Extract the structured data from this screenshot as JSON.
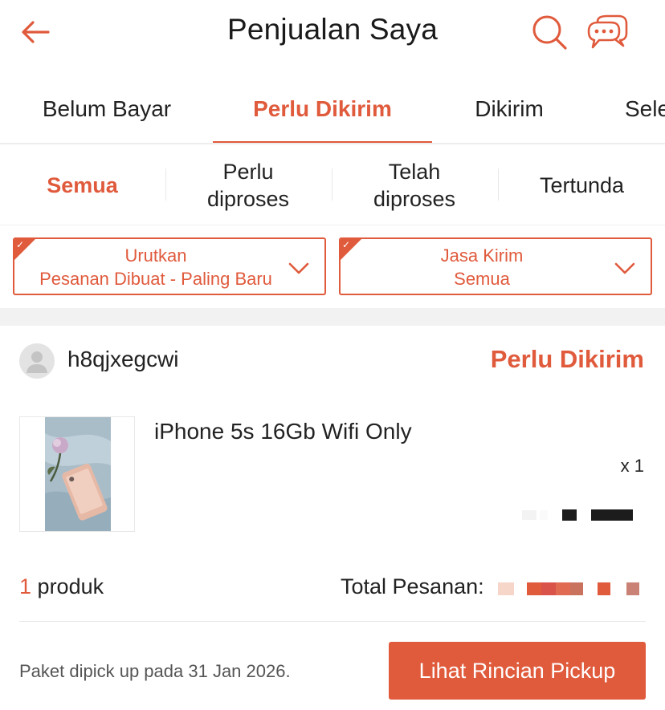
{
  "header": {
    "title": "Penjualan Saya",
    "back_icon": "arrow-left-icon",
    "search_icon": "search-icon",
    "chat_icon": "chat-icon",
    "accent_color": "#e05a3c"
  },
  "tabs": [
    {
      "label": "Belum Bayar",
      "active": false
    },
    {
      "label": "Perlu Dikirim",
      "active": true
    },
    {
      "label": "Dikirim",
      "active": false
    },
    {
      "label": "Selesai",
      "active": false
    }
  ],
  "subtabs": [
    {
      "label": "Semua",
      "active": true
    },
    {
      "label": "Perlu diproses",
      "active": false
    },
    {
      "label": "Telah diproses",
      "active": false
    },
    {
      "label": "Tertunda",
      "active": false
    }
  ],
  "filters": {
    "sort": {
      "label": "Urutkan",
      "value": "Pesanan Dibuat - Paling Baru"
    },
    "courier": {
      "label": "Jasa Kirim",
      "value": "Semua"
    }
  },
  "order": {
    "buyer": "h8qjxegcwi",
    "status": "Perlu Dikirim",
    "product_name": "iPhone 5s 16Gb Wifi Only",
    "quantity": "x 1",
    "product_count": "1",
    "product_count_label": "produk",
    "total_label": "Total Pesanan:",
    "pickup_note": "Paket dipick up pada 31 Jan 2026.",
    "pickup_button": "Lihat Rincian Pickup"
  }
}
